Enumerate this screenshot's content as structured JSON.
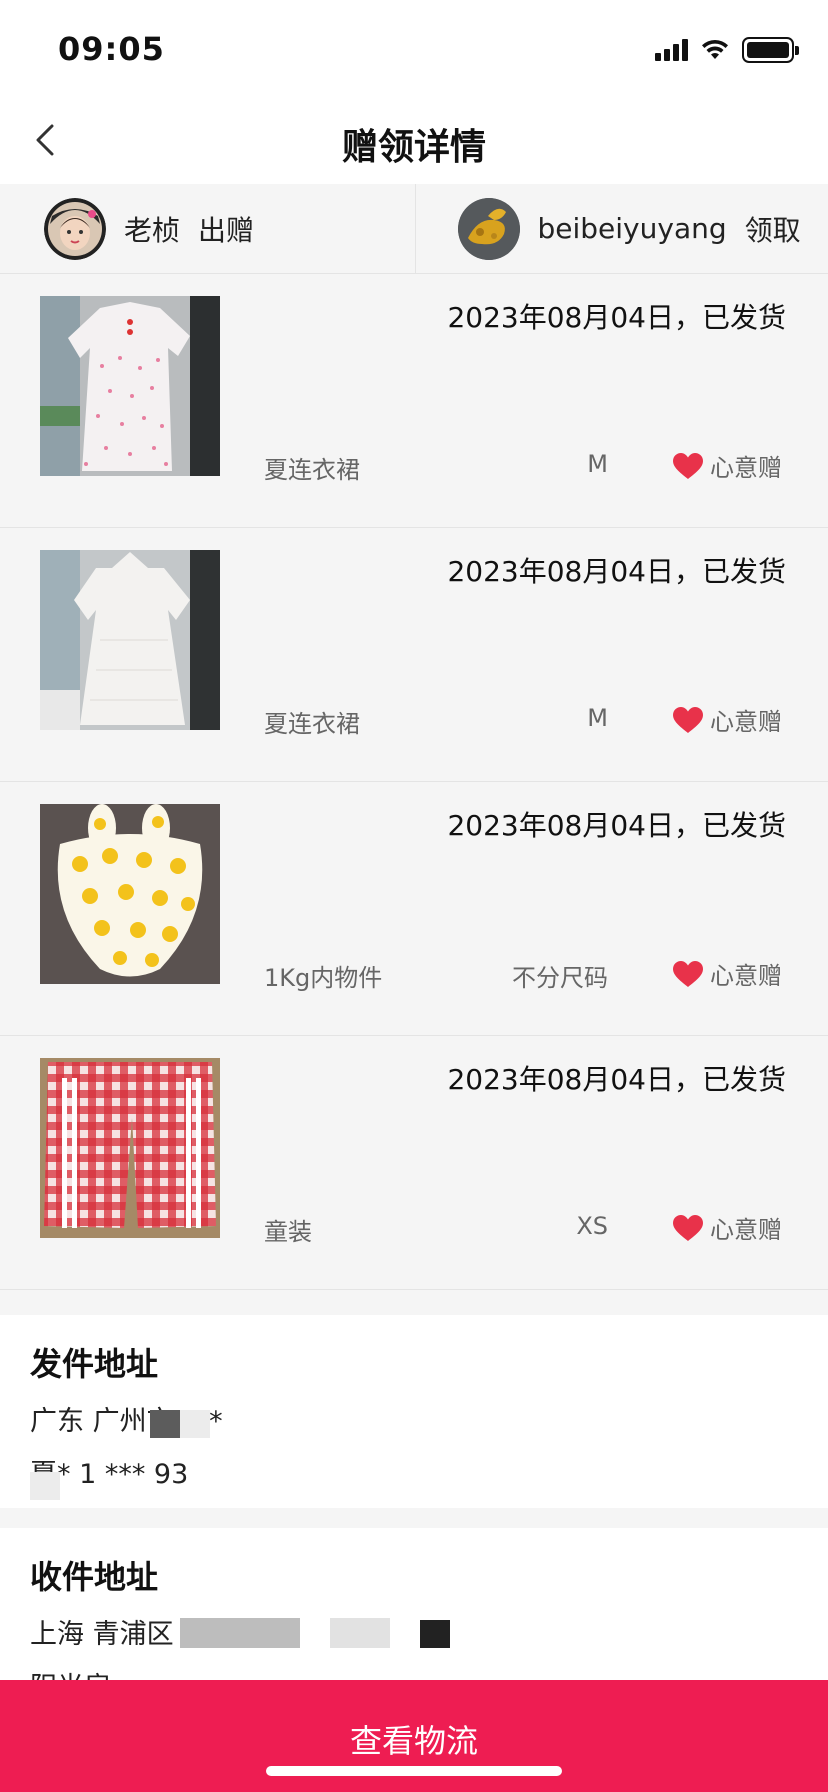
{
  "status_bar": {
    "time": "09:05"
  },
  "nav": {
    "title": "赠领详情"
  },
  "parties": {
    "giver": {
      "name": "老桢",
      "action": "出赠"
    },
    "receiver": {
      "name": "beibeiyuyang",
      "action": "领取"
    }
  },
  "items": [
    {
      "date": "2023年08月04日，已发货",
      "name": "夏连衣裙",
      "size": "M",
      "gift_type": "心意赠"
    },
    {
      "date": "2023年08月04日，已发货",
      "name": "夏连衣裙",
      "size": "M",
      "gift_type": "心意赠"
    },
    {
      "date": "2023年08月04日，已发货",
      "name": "1Kg内物件",
      "size": "不分尺码",
      "gift_type": "心意赠"
    },
    {
      "date": "2023年08月04日，已发货",
      "name": "童装",
      "size": "XS",
      "gift_type": "心意赠"
    }
  ],
  "sender_address": {
    "title": "发件地址",
    "line1": "广东 广州市 ***",
    "line2": "夏* 1 *** 93"
  },
  "receiver_address": {
    "title": "收件地址",
    "line1": "上海 青浦区 号",
    "line2": "阳光房"
  },
  "bottom": {
    "button_label": "查看物流"
  },
  "colors": {
    "accent": "#ee1d52",
    "heart": "#e8324a",
    "background": "#f5f5f5"
  }
}
